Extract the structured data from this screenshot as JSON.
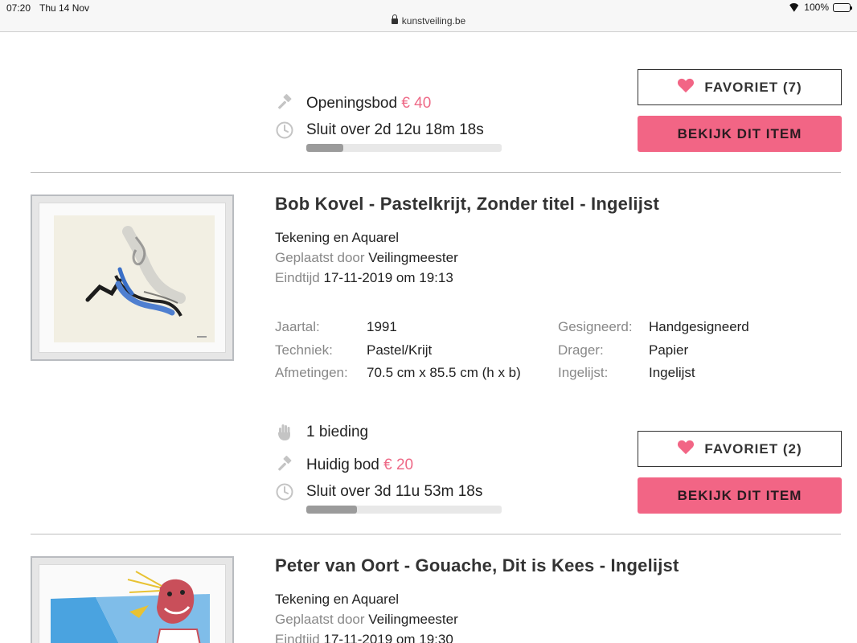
{
  "status_bar": {
    "time": "07:20",
    "date": "Thu 14 Nov",
    "url": "kunstveiling.be",
    "battery": "100%"
  },
  "colors": {
    "accent": "#f26585",
    "price": "#ee6a87"
  },
  "icons": {
    "gavel": "gavel-icon",
    "clock": "clock-icon",
    "hand": "hand-icon",
    "heart": "heart-icon",
    "lock": "lock-icon"
  },
  "lot1": {
    "bid_label": "Openingsbod",
    "bid_value": "€ 40",
    "closes": "Sluit over 2d 12u 18m 18s",
    "progress": 0.19,
    "favorite": "FAVORIET (7)",
    "view": "BEKIJK DIT ITEM"
  },
  "lot2": {
    "title": "Bob Kovel - Pastelkrijt, Zonder titel - Ingelijst",
    "category": "Tekening en Aquarel",
    "posted_label": "Geplaatst door",
    "posted_by": "Veilingmeester",
    "end_label": "Eindtijd",
    "end_time": "17-11-2019 om 19:13",
    "specs": {
      "year_label": "Jaartal:",
      "year": "1991",
      "technique_label": "Techniek:",
      "technique": "Pastel/Krijt",
      "size_label": "Afmetingen:",
      "size": "70.5 cm x 85.5 cm (h x b)",
      "signed_label": "Gesigneerd:",
      "signed": "Handgesigneerd",
      "carrier_label": "Drager:",
      "carrier": "Papier",
      "framed_label": "Ingelijst:",
      "framed": "Ingelijst"
    },
    "bids": "1 bieding",
    "bid_label": "Huidig bod",
    "bid_value": "€ 20",
    "closes": "Sluit over 3d 11u 53m 18s",
    "progress": 0.26,
    "favorite": "FAVORIET (2)",
    "view": "BEKIJK DIT ITEM"
  },
  "lot3": {
    "title": "Peter van Oort - Gouache, Dit is Kees - Ingelijst",
    "category": "Tekening en Aquarel",
    "posted_label": "Geplaatst door",
    "posted_by": "Veilingmeester",
    "end_label": "Eindtijd",
    "end_time": "17-11-2019 om 19:30"
  }
}
